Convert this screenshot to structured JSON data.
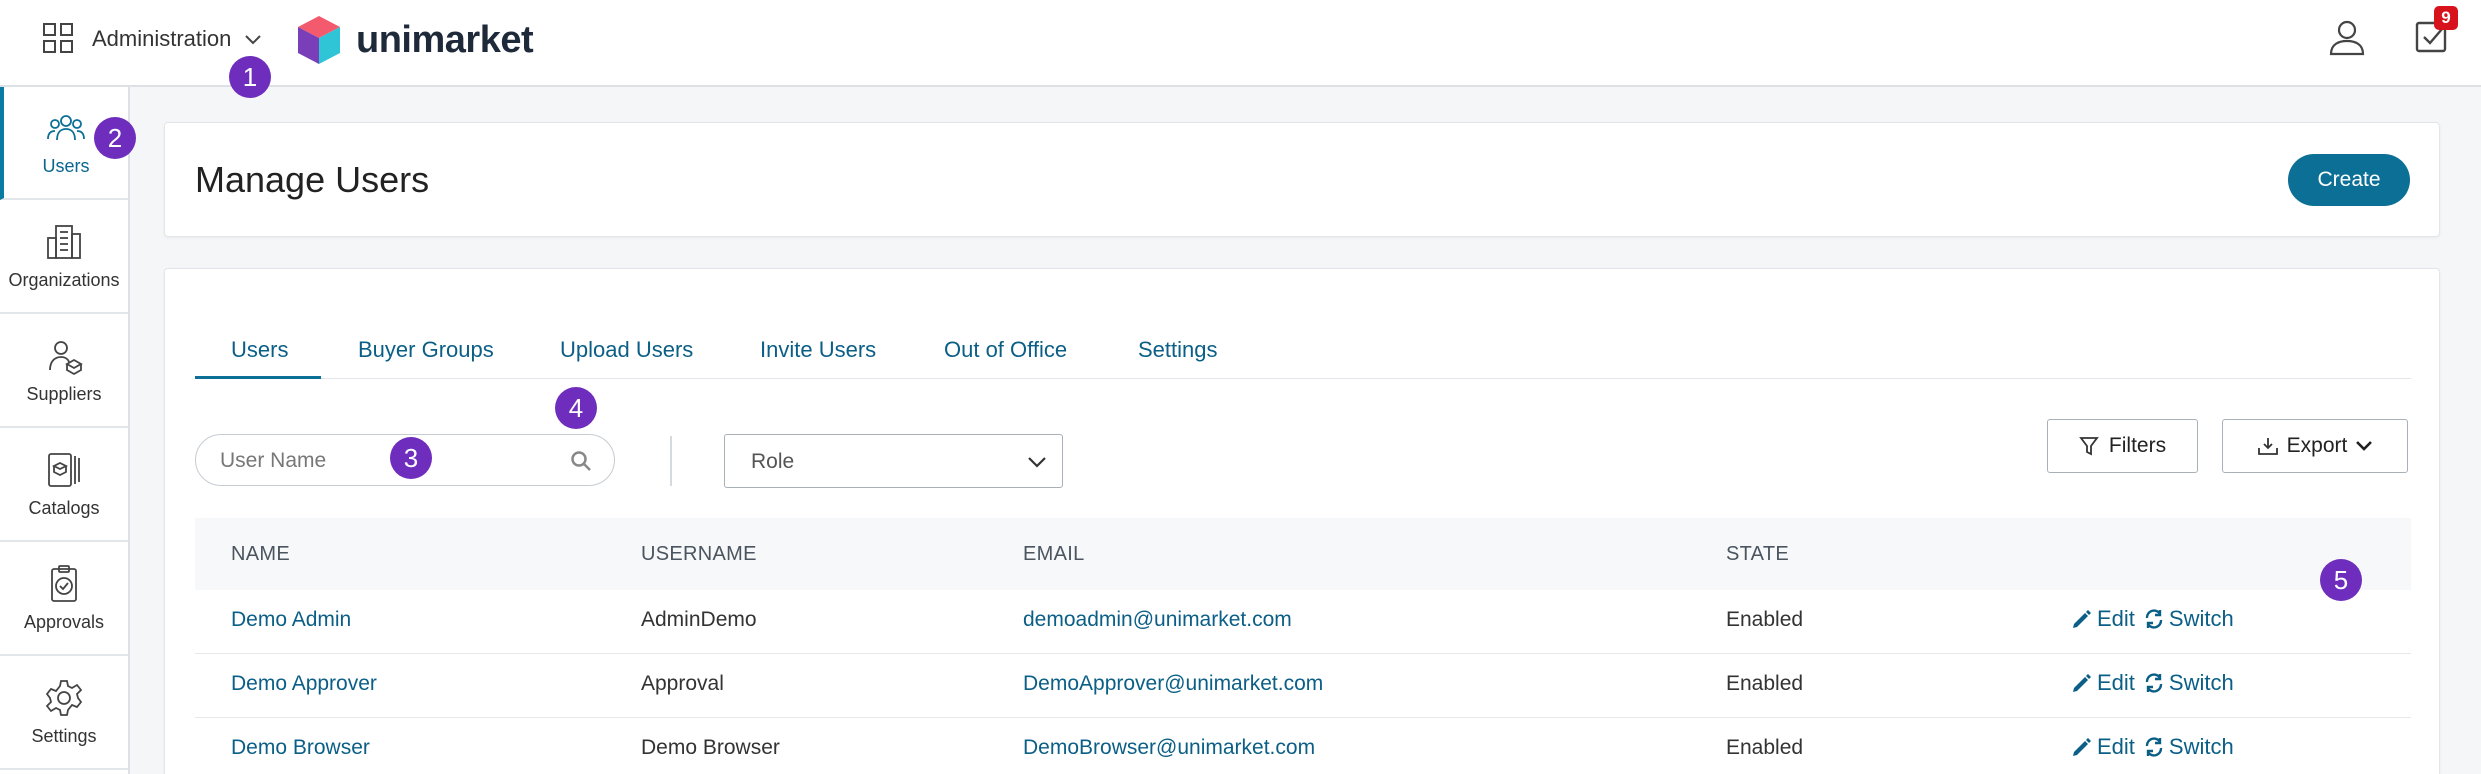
{
  "topbar": {
    "app_menu_label": "Administration",
    "logo_text": "unimarket",
    "tasks_count": "9"
  },
  "sidebar": {
    "items": [
      {
        "label": "Users",
        "icon": "users-icon"
      },
      {
        "label": "Organizations",
        "icon": "building-icon"
      },
      {
        "label": "Suppliers",
        "icon": "supplier-icon"
      },
      {
        "label": "Catalogs",
        "icon": "catalog-icon"
      },
      {
        "label": "Approvals",
        "icon": "approval-icon"
      },
      {
        "label": "Settings",
        "icon": "gear-icon"
      }
    ]
  },
  "steps": [
    "1",
    "2",
    "3",
    "4",
    "5"
  ],
  "header": {
    "title": "Manage Users",
    "create_label": "Create"
  },
  "tabs": [
    {
      "label": "Users"
    },
    {
      "label": "Buyer Groups"
    },
    {
      "label": "Upload Users"
    },
    {
      "label": "Invite Users"
    },
    {
      "label": "Out of Office"
    },
    {
      "label": "Settings"
    }
  ],
  "filters": {
    "search_placeholder": "User Name",
    "role_label": "Role",
    "filters_label": "Filters",
    "export_label": "Export"
  },
  "table": {
    "columns": [
      "NAME",
      "USERNAME",
      "EMAIL",
      "STATE"
    ],
    "rows": [
      {
        "name": "Demo Admin",
        "username": "AdminDemo",
        "email": "demoadmin@unimarket.com",
        "state": "Enabled",
        "edit": "Edit",
        "switch": "Switch"
      },
      {
        "name": "Demo Approver",
        "username": "Approval",
        "email": "DemoApprover@unimarket.com",
        "state": "Enabled",
        "edit": "Edit",
        "switch": "Switch"
      },
      {
        "name": "Demo Browser",
        "username": "Demo Browser",
        "email": "DemoBrowser@unimarket.com",
        "state": "Enabled",
        "edit": "Edit",
        "switch": "Switch"
      }
    ]
  },
  "colors": {
    "primary": "#0b6f96",
    "link": "#0b5f86",
    "step_bubble": "#6f2dbd",
    "badge": "#d8121c"
  }
}
